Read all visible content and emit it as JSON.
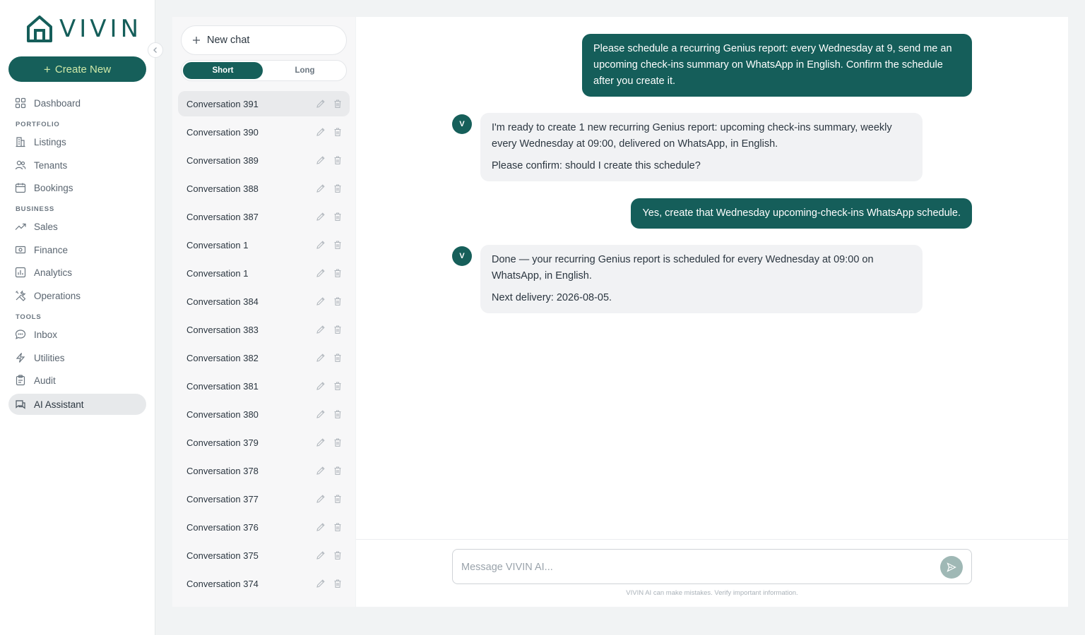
{
  "brand": {
    "logo_text": "VIVIN"
  },
  "sidebar": {
    "create_label": "Create New",
    "items": [
      {
        "label": "Dashboard",
        "icon": "grid-icon"
      },
      {
        "label": "Listings",
        "icon": "building-icon"
      },
      {
        "label": "Tenants",
        "icon": "users-icon"
      },
      {
        "label": "Bookings",
        "icon": "calendar-icon"
      },
      {
        "label": "Sales",
        "icon": "trend-up-icon"
      },
      {
        "label": "Finance",
        "icon": "banknote-icon"
      },
      {
        "label": "Analytics",
        "icon": "bar-chart-icon"
      },
      {
        "label": "Operations",
        "icon": "tools-icon"
      },
      {
        "label": "Inbox",
        "icon": "chat-bubble-icon"
      },
      {
        "label": "Utilities",
        "icon": "lightning-icon"
      },
      {
        "label": "Audit",
        "icon": "clipboard-icon"
      },
      {
        "label": "AI Assistant",
        "icon": "messages-icon"
      }
    ],
    "sections": [
      "PORTFOLIO",
      "BUSINESS",
      "TOOLS"
    ]
  },
  "conversations": {
    "new_chat_label": "New chat",
    "toggle": {
      "short": "Short",
      "long": "Long",
      "selected": "Short"
    },
    "items": [
      "Conversation 391",
      "Conversation 390",
      "Conversation 389",
      "Conversation 388",
      "Conversation 387",
      "Conversation 1",
      "Conversation 1",
      "Conversation 384",
      "Conversation 383",
      "Conversation 382",
      "Conversation 381",
      "Conversation 380",
      "Conversation 379",
      "Conversation 378",
      "Conversation 377",
      "Conversation 376",
      "Conversation 375",
      "Conversation 374"
    ]
  },
  "chat": {
    "avatar_letter": "V",
    "messages": [
      {
        "role": "user",
        "text": "Please schedule a recurring Genius report: every Wednesday at 9, send me an upcoming check-ins summary on WhatsApp in English. Confirm the schedule after you create it."
      },
      {
        "role": "assistant",
        "p1": "I'm ready to create 1 new recurring Genius report: upcoming check-ins summary, weekly every Wednesday at 09:00, delivered on WhatsApp, in English.",
        "p2": "Please confirm: should I create this schedule?"
      },
      {
        "role": "user",
        "text": "Yes, create that Wednesday upcoming-check-ins WhatsApp schedule."
      },
      {
        "role": "assistant",
        "p1": "Done — your recurring Genius report is scheduled for every Wednesday at 09:00 on WhatsApp, in English.",
        "p2": "Next delivery: 2026-08-05."
      }
    ],
    "composer_placeholder": "Message VIVIN AI...",
    "disclaimer": "VIVIN AI can make mistakes. Verify important information."
  },
  "colors": {
    "brand": "#165f5a",
    "create_text": "#cfe9a8",
    "user_bubble": "#155e5a",
    "bot_bubble": "#f1f2f4"
  }
}
